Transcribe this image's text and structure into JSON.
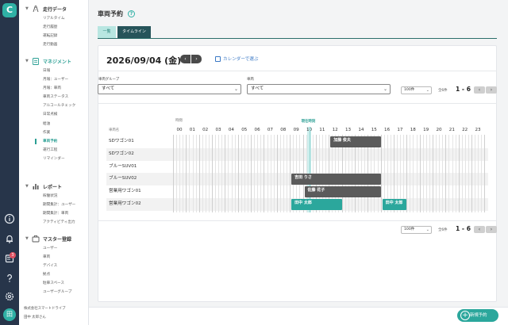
{
  "rail": {
    "logo": "C",
    "badge_count": "3",
    "avatar_initial": "田"
  },
  "sidebar": {
    "sections": [
      {
        "title": "走行データ",
        "icon": "route-icon",
        "items": [
          "リアルタイム",
          "走行履歴",
          "運転記録",
          "走行動画"
        ]
      },
      {
        "title": "マネジメント",
        "icon": "clipboard-icon",
        "items": [
          "日報",
          "月報：ユーザー",
          "月報：車両",
          "車両ステータス",
          "アルコールチェック",
          "日常点検",
          "給油",
          "作業",
          "車両予約",
          "運行工程",
          "リマインダー"
        ]
      },
      {
        "title": "レポート",
        "icon": "bar-chart-icon",
        "items": [
          "稼働状況",
          "期間集計：ユーザー",
          "期間集計：車両",
          "アクティビティ出力"
        ]
      },
      {
        "title": "マスター登録",
        "icon": "briefcase-icon",
        "items": [
          "ユーザー",
          "車両",
          "デバイス",
          "拠点",
          "駐車スペース",
          "ユーザーグループ"
        ]
      }
    ],
    "company": "株式会社スマートドライブ",
    "user": "田中 太郎さん"
  },
  "page": {
    "title": "車両予約",
    "help": "?",
    "tabs": [
      "一覧",
      "タイムライン"
    ],
    "date": "2026/09/04 (金)",
    "prev": "‹",
    "next": "›",
    "calendar_link": "カレンダーで選ぶ"
  },
  "filters": {
    "group_label": "車両グループ",
    "group_value": "すべて",
    "vehicle_label": "車両",
    "vehicle_value": "すべて",
    "per_page": "100件",
    "total": "全6件",
    "range": "1 - 6",
    "prev": "‹",
    "next": "›"
  },
  "timeline": {
    "time_label": "時間",
    "now_label": "現在時刻",
    "vehicle_col_label": "車両名",
    "hours": [
      "00",
      "01",
      "02",
      "03",
      "04",
      "05",
      "06",
      "07",
      "08",
      "09",
      "10",
      "11",
      "12",
      "13",
      "14",
      "15",
      "16",
      "17",
      "18",
      "19",
      "20",
      "21",
      "22",
      "23"
    ],
    "rows": [
      "SDワゴン01",
      "SDワゴン02",
      "ブルーSUV01",
      "ブルーSUV02",
      "営業用ワゴン01",
      "営業用ワゴン02"
    ],
    "now_hour": 10.0,
    "reservations": [
      {
        "row": 0,
        "start": 12.0,
        "end": 16.0,
        "name": "加藤 俊夫",
        "color": "#5b5b5b",
        "kind": "gray"
      },
      {
        "row": 3,
        "start": 9.0,
        "end": 16.0,
        "name": "吉田 りさ",
        "color": "#5b5b5b",
        "kind": "gray"
      },
      {
        "row": 4,
        "start": 10.0,
        "end": 16.0,
        "name": "佐藤 花子",
        "color": "#5b5b5b",
        "kind": "gray"
      },
      {
        "row": 5,
        "start": 9.0,
        "end": 13.0,
        "name": "田中 太郎",
        "color": "#2ba79c",
        "kind": "teal"
      },
      {
        "row": 5,
        "start": 16.0,
        "end": 18.0,
        "name": "田中 太郎",
        "color": "#2ba79c",
        "kind": "teal"
      }
    ]
  },
  "footer": {
    "per_page": "100件",
    "total": "全6件",
    "range": "1 - 6",
    "prev": "‹",
    "next": "›",
    "new_button": "新規予約",
    "plus": "+"
  },
  "colors": {
    "accent": "#2ba79c",
    "rail": "#27354a",
    "reservation_gray": "#5b5b5b"
  }
}
